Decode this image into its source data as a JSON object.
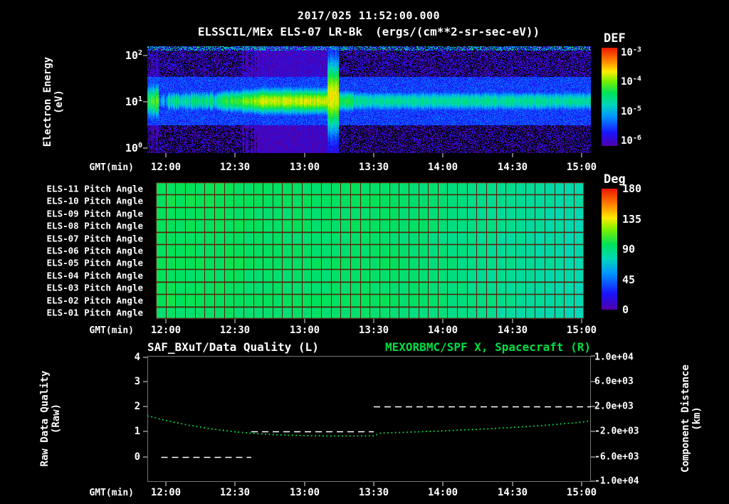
{
  "header": {
    "date_title": "2017/025 11:52:00.000",
    "instrument_title": "ELSSCIL/MEx ELS-07 LR-Bk",
    "units_title": "(ergs/(cm**2-sr-sec-eV))"
  },
  "time_axis": {
    "label": "GMT(min)",
    "ticks": [
      "12:00",
      "12:30",
      "13:00",
      "13:30",
      "14:00",
      "14:30",
      "15:00"
    ]
  },
  "panel1": {
    "ylabel_line1": "Electron Energy",
    "ylabel_line2": "(eV)",
    "ytick_base": "10",
    "ytick_exps": [
      "2",
      "1",
      "0"
    ],
    "colorbar": {
      "label": "DEF",
      "tick_base": "10",
      "tick_exps": [
        "-3",
        "-4",
        "-5",
        "-6"
      ]
    }
  },
  "panel2": {
    "row_labels": [
      "ELS-11 Pitch Angle",
      "ELS-10 Pitch Angle",
      "ELS-09 Pitch Angle",
      "ELS-08 Pitch Angle",
      "ELS-07 Pitch Angle",
      "ELS-06 Pitch Angle",
      "ELS-05 Pitch Angle",
      "ELS-04 Pitch Angle",
      "ELS-03 Pitch Angle",
      "ELS-02 Pitch Angle",
      "ELS-01 Pitch Angle"
    ],
    "colorbar": {
      "label": "Deg",
      "ticks": [
        "180",
        "135",
        "90",
        "45",
        "0"
      ]
    }
  },
  "panel3": {
    "title_left": "SAF_BXuT/Data Quality (L)",
    "title_right": "MEXORBMC/SPF X, Spacecraft (R)",
    "ylabel_left_line1": "Raw Data Quality",
    "ylabel_left_line2": "(Raw)",
    "ylabel_right_line1": "Component Distance",
    "ylabel_right_line2": "(km)",
    "left_ticks": [
      "4",
      "3",
      "2",
      "1",
      "0"
    ],
    "right_ticks": [
      "1.0e+04",
      "6.0e+03",
      "2.0e+03",
      "-2.0e+03",
      "-6.0e+03",
      "-1.0e+04"
    ]
  },
  "colors": {
    "background": "#000000",
    "text": "#ffffff",
    "accent_green": "#00dd44",
    "grid_red": "#5e1c04"
  },
  "chart_data": [
    {
      "type": "heatmap",
      "name": "electron-energy-spectrogram",
      "title": "ELSSCIL/MEx ELS-07 LR-Bk",
      "units": "ergs/(cm**2-sr-sec-eV)",
      "time_start": "11:52",
      "time_end": "15:04",
      "x_ticks": [
        "12:00",
        "12:30",
        "13:00",
        "13:30",
        "14:00",
        "14:30",
        "15:00"
      ],
      "y_scale": "log",
      "y_ticks_ev": [
        1,
        10,
        100
      ],
      "y_range_log10_ev": [
        -0.1,
        2.2
      ],
      "colorbar": {
        "label": "DEF",
        "log10_range": [
          -6,
          -3
        ]
      },
      "features": {
        "background_log10_def": -5.45,
        "band_center_ev": 10.5,
        "band_sigma_decades": 0.2,
        "band_intensity_log10": [
          {
            "t0": "11:52",
            "t1": "11:57",
            "v": -4.25
          },
          {
            "t0": "11:57",
            "t1": "12:01",
            "v": -5.0
          },
          {
            "t0": "12:01",
            "t1": "12:24",
            "v": -4.6
          },
          {
            "t0": "12:24",
            "t1": "12:33",
            "v": -4.25
          },
          {
            "t0": "12:33",
            "t1": "12:40",
            "v": -4.0
          },
          {
            "t0": "12:40",
            "t1": "13:10",
            "v": -3.85
          },
          {
            "t0": "13:10",
            "t1": "13:15",
            "v": -3.78
          },
          {
            "t0": "13:15",
            "t1": "13:21",
            "v": -4.35
          },
          {
            "t0": "13:21",
            "t1": "15:04",
            "v": -4.62
          }
        ],
        "spike": {
          "t0": "13:10",
          "t1": "13:15",
          "sigma_decades": 0.55,
          "center_log10_ev": 1.12,
          "max_energy_ev": 60
        },
        "dark_speckle_below_ev": 3,
        "dark_speckle_above_ev": 40
      }
    },
    {
      "type": "heatmap",
      "name": "pitch-angle-panel",
      "rows": [
        "ELS-11",
        "ELS-10",
        "ELS-09",
        "ELS-08",
        "ELS-07",
        "ELS-06",
        "ELS-05",
        "ELS-04",
        "ELS-03",
        "ELS-02",
        "ELS-01"
      ],
      "colorbar": {
        "label": "Deg",
        "range": [
          0,
          180
        ]
      },
      "values_deg": {
        "left_mean": 94,
        "right_mean": 77,
        "transition_start_frac": 0.52
      },
      "grid": true,
      "time_start": "11:52",
      "time_end": "15:04"
    },
    {
      "type": "line",
      "name": "quality-and-spacecraft-x",
      "time_start": "11:52",
      "time_end": "15:04",
      "x_ticks": [
        "12:00",
        "12:30",
        "13:00",
        "13:30",
        "14:00",
        "14:30",
        "15:00"
      ],
      "left_axis": {
        "label": "Raw Data Quality (Raw)",
        "range": [
          -1,
          4
        ],
        "ticks": [
          4,
          3,
          2,
          1,
          0
        ]
      },
      "right_axis": {
        "label": "Component Distance (km)",
        "range": [
          -10000,
          10000
        ],
        "ticks": [
          10000,
          6000,
          2000,
          -2000,
          -6000,
          -10000
        ]
      },
      "series": [
        {
          "name": "SAF_BXuT/Data Quality (L)",
          "axis": "left",
          "style": {
            "color": "#ffffff",
            "dash": "dashed"
          },
          "segments": [
            {
              "t0": "11:58",
              "t1": "12:37",
              "value": 0
            },
            {
              "t0": "12:37",
              "t1": "13:30",
              "value": 1
            },
            {
              "t0": "13:30",
              "t1": "15:04",
              "value": 2
            }
          ]
        },
        {
          "name": "MEXORBMC/SPF X, Spacecraft (R)",
          "axis": "right",
          "style": {
            "color": "#00dd44",
            "dash": "dotted"
          },
          "t": [
            "11:52",
            "12:00",
            "12:10",
            "12:20",
            "12:30",
            "12:40",
            "12:50",
            "13:00",
            "13:15",
            "13:30",
            "13:33",
            "13:45",
            "14:00",
            "14:15",
            "14:30",
            "14:45",
            "15:00",
            "15:04"
          ],
          "km": [
            500,
            -250,
            -1000,
            -1600,
            -2050,
            -2350,
            -2550,
            -2650,
            -2710,
            -2700,
            -2250,
            -2100,
            -1900,
            -1650,
            -1350,
            -1000,
            -500,
            -300
          ]
        }
      ]
    }
  ]
}
